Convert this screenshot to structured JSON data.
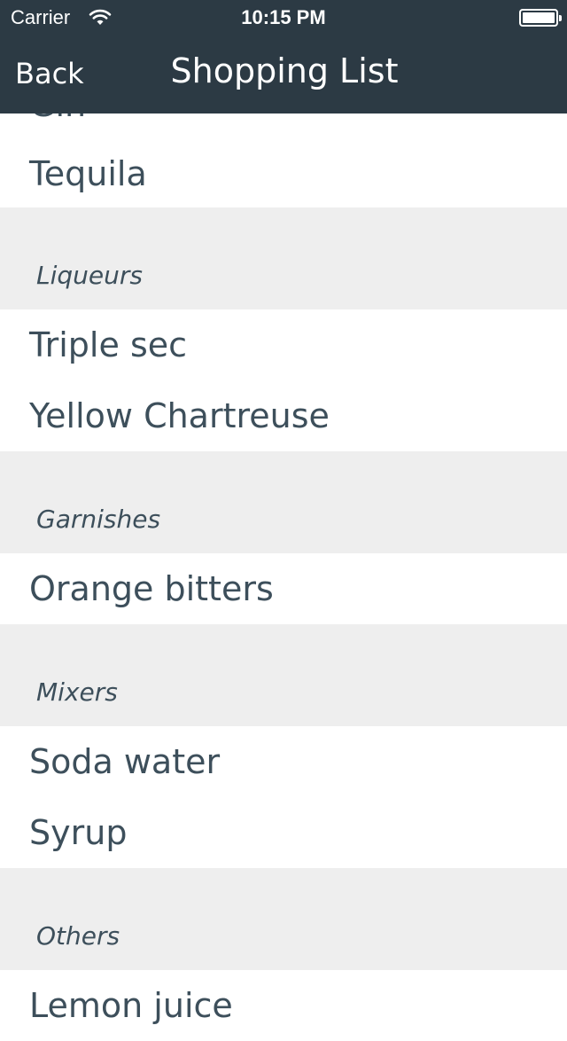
{
  "status_bar": {
    "carrier": "Carrier",
    "time": "10:15 PM"
  },
  "nav": {
    "back_label": "Back",
    "title": "Shopping List"
  },
  "list": {
    "partial_top_item": "Gin",
    "items_before": [
      "Tequila"
    ],
    "sections": [
      {
        "name": "Liqueurs",
        "items": [
          "Triple sec",
          "Yellow Chartreuse"
        ]
      },
      {
        "name": "Garnishes",
        "items": [
          "Orange bitters"
        ]
      },
      {
        "name": "Mixers",
        "items": [
          "Soda water",
          "Syrup"
        ]
      },
      {
        "name": "Others",
        "items": [
          "Lemon juice"
        ]
      }
    ]
  },
  "colors": {
    "nav_background": "#2c3a44",
    "text": "#3d4f5b",
    "section_background": "#eeeeee"
  }
}
